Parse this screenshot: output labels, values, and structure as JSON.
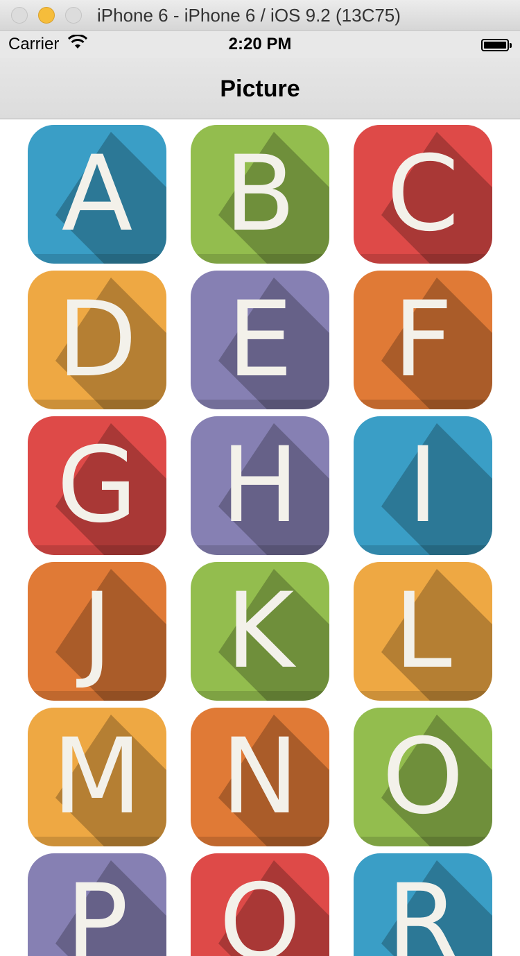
{
  "window": {
    "title": "iPhone 6 - iPhone 6 / iOS 9.2 (13C75)"
  },
  "status_bar": {
    "carrier": "Carrier",
    "time": "2:20 PM"
  },
  "nav": {
    "title": "Picture"
  },
  "tiles": [
    {
      "letter": "A",
      "color": "#3a9ec6"
    },
    {
      "letter": "B",
      "color": "#93bd4e"
    },
    {
      "letter": "C",
      "color": "#de4a48"
    },
    {
      "letter": "D",
      "color": "#eea843"
    },
    {
      "letter": "E",
      "color": "#8680b3"
    },
    {
      "letter": "F",
      "color": "#e07a36"
    },
    {
      "letter": "G",
      "color": "#de4a48"
    },
    {
      "letter": "H",
      "color": "#8680b3"
    },
    {
      "letter": "I",
      "color": "#3a9ec6"
    },
    {
      "letter": "J",
      "color": "#e07a36"
    },
    {
      "letter": "K",
      "color": "#93bd4e"
    },
    {
      "letter": "L",
      "color": "#eea843"
    },
    {
      "letter": "M",
      "color": "#eea843"
    },
    {
      "letter": "N",
      "color": "#e07a36"
    },
    {
      "letter": "O",
      "color": "#93bd4e"
    },
    {
      "letter": "P",
      "color": "#8680b3"
    },
    {
      "letter": "Q",
      "color": "#de4a48"
    },
    {
      "letter": "R",
      "color": "#3a9ec6"
    }
  ]
}
